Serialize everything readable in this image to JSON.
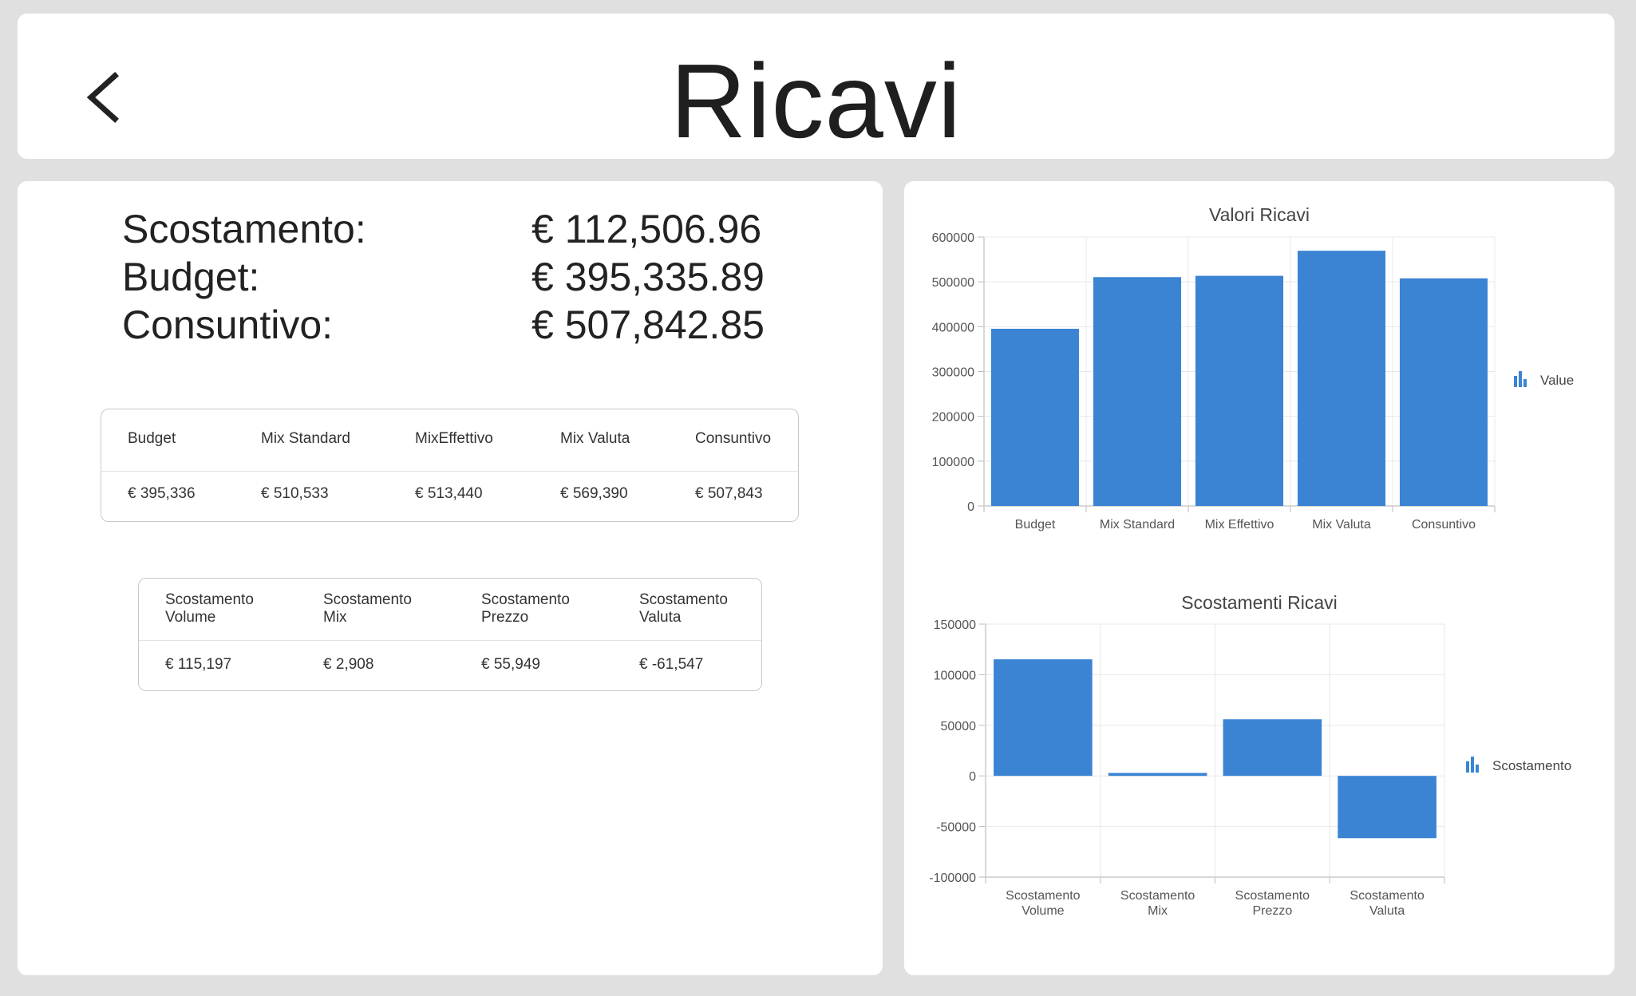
{
  "header": {
    "title": "Ricavi",
    "back_icon": "chevron-left-icon"
  },
  "summary": {
    "rows": [
      {
        "label": "Scostamento:",
        "value": "€ 112,506.96"
      },
      {
        "label": "Budget:",
        "value": "€ 395,335.89"
      },
      {
        "label": "Consuntivo:",
        "value": "€ 507,842.85"
      }
    ]
  },
  "table1": {
    "headers": [
      "Budget",
      "Mix Standard",
      "MixEffettivo",
      "Mix Valuta",
      "Consuntivo"
    ],
    "values": [
      "€ 395,336",
      "€ 510,533",
      "€ 513,440",
      "€ 569,390",
      "€ 507,843"
    ]
  },
  "table2": {
    "headers": [
      "Scostamento\nVolume",
      "Scostamento\nMix",
      "Scostamento\nPrezzo",
      "Scostamento\nValuta"
    ],
    "values": [
      "€ 115,197",
      "€ 2,908",
      "€ 55,949",
      "€ -61,547"
    ]
  },
  "colors": {
    "bar": "#3b84d4",
    "background": "#e0e0e0",
    "card": "#ffffff"
  },
  "chart_data": [
    {
      "type": "bar",
      "title": "Valori Ricavi",
      "categories": [
        "Budget",
        "Mix Standard",
        "Mix Effettivo",
        "Mix Valuta",
        "Consuntivo"
      ],
      "series": [
        {
          "name": "Value",
          "values": [
            395336,
            510533,
            513440,
            569390,
            507843
          ]
        }
      ],
      "ylim": [
        0,
        600000
      ],
      "yticks": [
        "600000",
        "500000",
        "400000",
        "300000",
        "200000",
        "100000",
        "0"
      ],
      "legend_icon": "bar-chart-icon",
      "legend_position": "right",
      "grid": true
    },
    {
      "type": "bar",
      "title": "Scostamenti Ricavi",
      "categories": [
        "Scostamento\nVolume",
        "Scostamento\nMix",
        "Scostamento\nPrezzo",
        "Scostamento\nValuta"
      ],
      "series": [
        {
          "name": "Scostamento",
          "values": [
            115197,
            2908,
            55949,
            -61547
          ]
        }
      ],
      "ylim": [
        -100000,
        150000
      ],
      "yticks": [
        "150000",
        "100000",
        "50000",
        "0",
        "-50000",
        "-100000"
      ],
      "legend_icon": "bar-chart-icon",
      "legend_position": "right",
      "grid": true
    }
  ]
}
